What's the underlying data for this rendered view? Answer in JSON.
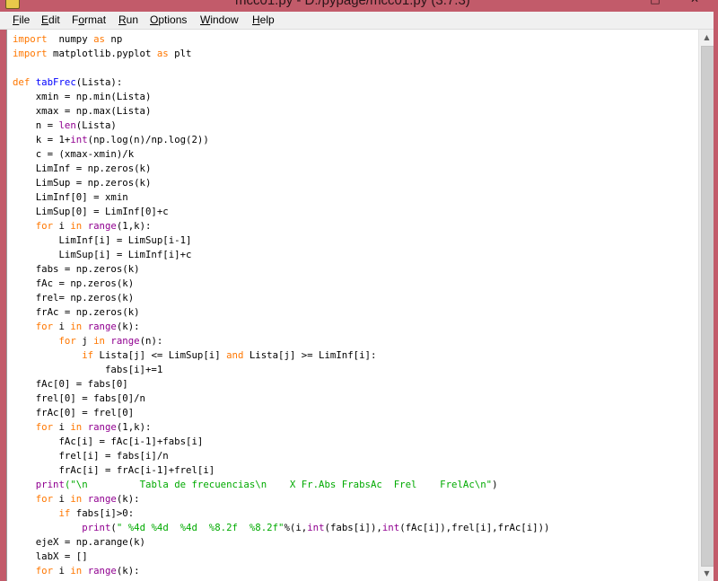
{
  "window": {
    "title": "mcc01.py - D:/pypage/mcc01.py (3.7.3)",
    "controls": [
      "–",
      "□",
      "✕"
    ]
  },
  "menu": [
    {
      "mnemonic": "F",
      "rest": "ile"
    },
    {
      "mnemonic": "E",
      "rest": "dit"
    },
    {
      "mnemonic": "",
      "pre": "F",
      "mnemonic2": "o",
      "rest": "rmat"
    },
    {
      "mnemonic": "R",
      "rest": "un"
    },
    {
      "mnemonic": "O",
      "rest": "ptions"
    },
    {
      "mnemonic": "W",
      "rest": "indow"
    },
    {
      "mnemonic": "H",
      "rest": "elp"
    }
  ],
  "colors": {
    "keyword": "#ff7700",
    "builtin": "#900090",
    "definition": "#0000ff",
    "string": "#00aa00",
    "titlebar": "#c25b6a"
  },
  "icons": {
    "title": "python-file-icon",
    "scroll_up": "up-arrow-icon",
    "scroll_down": "down-arrow-icon"
  },
  "code": [
    [
      [
        "kw",
        "import"
      ],
      [
        "",
        "  numpy "
      ],
      [
        "kw",
        "as"
      ],
      [
        "",
        " np"
      ]
    ],
    [
      [
        "kw",
        "import"
      ],
      [
        "",
        " matplotlib.pyplot "
      ],
      [
        "kw",
        "as"
      ],
      [
        "",
        " plt"
      ]
    ],
    [],
    [
      [
        "kw",
        "def"
      ],
      [
        "",
        " "
      ],
      [
        "fn",
        "tabFrec"
      ],
      [
        "",
        "(Lista):"
      ]
    ],
    [
      [
        "",
        "    xmin = np.min(Lista)"
      ]
    ],
    [
      [
        "",
        "    xmax = np.max(Lista)"
      ]
    ],
    [
      [
        "",
        "    n = "
      ],
      [
        "bi",
        "len"
      ],
      [
        "",
        "(Lista)"
      ]
    ],
    [
      [
        "",
        "    k = 1+"
      ],
      [
        "bi",
        "int"
      ],
      [
        "",
        "(np.log(n)/np.log(2))"
      ]
    ],
    [
      [
        "",
        "    c = (xmax-xmin)/k"
      ]
    ],
    [
      [
        "",
        "    LimInf = np.zeros(k)"
      ]
    ],
    [
      [
        "",
        "    LimSup = np.zeros(k)"
      ]
    ],
    [
      [
        "",
        "    LimInf[0] = xmin"
      ]
    ],
    [
      [
        "",
        "    LimSup[0] = LimInf[0]+c"
      ]
    ],
    [
      [
        "",
        "    "
      ],
      [
        "kw",
        "for"
      ],
      [
        "",
        " i "
      ],
      [
        "kw",
        "in"
      ],
      [
        "",
        " "
      ],
      [
        "bi",
        "range"
      ],
      [
        "",
        "(1,k):"
      ]
    ],
    [
      [
        "",
        "        LimInf[i] = LimSup[i-1]"
      ]
    ],
    [
      [
        "",
        "        LimSup[i] = LimInf[i]+c"
      ]
    ],
    [
      [
        "",
        "    fabs = np.zeros(k)"
      ]
    ],
    [
      [
        "",
        "    fAc = np.zeros(k)"
      ]
    ],
    [
      [
        "",
        "    frel= np.zeros(k)"
      ]
    ],
    [
      [
        "",
        "    frAc = np.zeros(k)"
      ]
    ],
    [
      [
        "",
        "    "
      ],
      [
        "kw",
        "for"
      ],
      [
        "",
        " i "
      ],
      [
        "kw",
        "in"
      ],
      [
        "",
        " "
      ],
      [
        "bi",
        "range"
      ],
      [
        "",
        "(k):"
      ]
    ],
    [
      [
        "",
        "        "
      ],
      [
        "kw",
        "for"
      ],
      [
        "",
        " j "
      ],
      [
        "kw",
        "in"
      ],
      [
        "",
        " "
      ],
      [
        "bi",
        "range"
      ],
      [
        "",
        "(n):"
      ]
    ],
    [
      [
        "",
        "            "
      ],
      [
        "kw",
        "if"
      ],
      [
        "",
        " Lista[j] <= LimSup[i] "
      ],
      [
        "kw",
        "and"
      ],
      [
        "",
        " Lista[j] >= LimInf[i]:"
      ]
    ],
    [
      [
        "",
        "                fabs[i]+=1"
      ]
    ],
    [
      [
        "",
        "    fAc[0] = fabs[0]"
      ]
    ],
    [
      [
        "",
        "    frel[0] = fabs[0]/n"
      ]
    ],
    [
      [
        "",
        "    frAc[0] = frel[0]"
      ]
    ],
    [
      [
        "",
        "    "
      ],
      [
        "kw",
        "for"
      ],
      [
        "",
        " i "
      ],
      [
        "kw",
        "in"
      ],
      [
        "",
        " "
      ],
      [
        "bi",
        "range"
      ],
      [
        "",
        "(1,k):"
      ]
    ],
    [
      [
        "",
        "        fAc[i] = fAc[i-1]+fabs[i]"
      ]
    ],
    [
      [
        "",
        "        frel[i] = fabs[i]/n"
      ]
    ],
    [
      [
        "",
        "        frAc[i] = frAc[i-1]+frel[i]"
      ]
    ],
    [
      [
        "",
        "    "
      ],
      [
        "bi",
        "print"
      ],
      [
        "st",
        "(\"\\n         Tabla de frecuencias\\n    X Fr.Abs FrabsAc  Frel    FrelAc\\n\""
      ],
      [
        "",
        ")"
      ]
    ],
    [
      [
        "",
        "    "
      ],
      [
        "kw",
        "for"
      ],
      [
        "",
        " i "
      ],
      [
        "kw",
        "in"
      ],
      [
        "",
        " "
      ],
      [
        "bi",
        "range"
      ],
      [
        "",
        "(k):"
      ]
    ],
    [
      [
        "",
        "        "
      ],
      [
        "kw",
        "if"
      ],
      [
        "",
        " fabs[i]>0:"
      ]
    ],
    [
      [
        "",
        "            "
      ],
      [
        "bi",
        "print"
      ],
      [
        "",
        "("
      ],
      [
        "st",
        "\" %4d %4d  %4d  %8.2f  %8.2f\""
      ],
      [
        "",
        "%(i,"
      ],
      [
        "bi",
        "int"
      ],
      [
        "",
        "(fabs[i]),"
      ],
      [
        "bi",
        "int"
      ],
      [
        "",
        "(fAc[i]),frel[i],frAc[i]))"
      ]
    ],
    [
      [
        "",
        "    ejeX = np.arange(k)"
      ]
    ],
    [
      [
        "",
        "    labX = []"
      ]
    ],
    [
      [
        "",
        "    "
      ],
      [
        "kw",
        "for"
      ],
      [
        "",
        " i "
      ],
      [
        "kw",
        "in"
      ],
      [
        "",
        " "
      ],
      [
        "bi",
        "range"
      ],
      [
        "",
        "(k):"
      ]
    ]
  ]
}
